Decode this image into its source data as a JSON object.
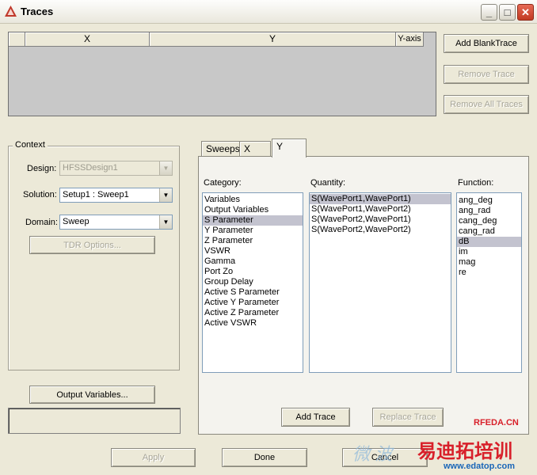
{
  "window": {
    "title": "Traces"
  },
  "titlebar_buttons": {
    "minimize": "_",
    "maximize": "□",
    "close": "✕"
  },
  "trace_table": {
    "columns": [
      "X",
      "Y",
      "Y-axis"
    ]
  },
  "trace_buttons": {
    "add_blank": "Add BlankTrace",
    "remove": "Remove Trace",
    "remove_all": "Remove All Traces"
  },
  "context": {
    "label": "Context",
    "design_label": "Design:",
    "design_value": "HFSSDesign1",
    "solution_label": "Solution:",
    "solution_value": "Setup1 : Sweep1",
    "domain_label": "Domain:",
    "domain_value": "Sweep",
    "tdr_button": "TDR Options..."
  },
  "output_variables_button": "Output Variables...",
  "tabs": [
    "Sweeps",
    "X",
    "Y"
  ],
  "category": {
    "label": "Category:",
    "items": [
      "Variables",
      "Output Variables",
      "S Parameter",
      "Y Parameter",
      "Z Parameter",
      "VSWR",
      "Gamma",
      "Port Zo",
      "Group Delay",
      "Active S Parameter",
      "Active Y Parameter",
      "Active Z Parameter",
      "Active VSWR"
    ],
    "selected": 2
  },
  "quantity": {
    "label": "Quantity:",
    "items": [
      "S(WavePort1,WavePort1)",
      "S(WavePort1,WavePort2)",
      "S(WavePort2,WavePort1)",
      "S(WavePort2,WavePort2)"
    ],
    "selected": 0
  },
  "function": {
    "label": "Function:",
    "items": [
      "ang_deg",
      "ang_rad",
      "cang_deg",
      "cang_rad",
      "dB",
      "im",
      "mag",
      "re"
    ],
    "selected": 4
  },
  "panel_buttons": {
    "add_trace": "Add Trace",
    "replace_trace": "Replace Trace"
  },
  "bottom_buttons": {
    "apply": "Apply",
    "done": "Done",
    "cancel": "Cancel"
  },
  "watermark": {
    "brand": "RFEDA.CN",
    "chinese": "易迪拓培训",
    "url": "www.edatop.com",
    "faint": "微 波"
  },
  "colors": {
    "selection": "#c3c3cf",
    "watermark_red": "#d8202a",
    "watermark_blue": "#1a66b8"
  }
}
